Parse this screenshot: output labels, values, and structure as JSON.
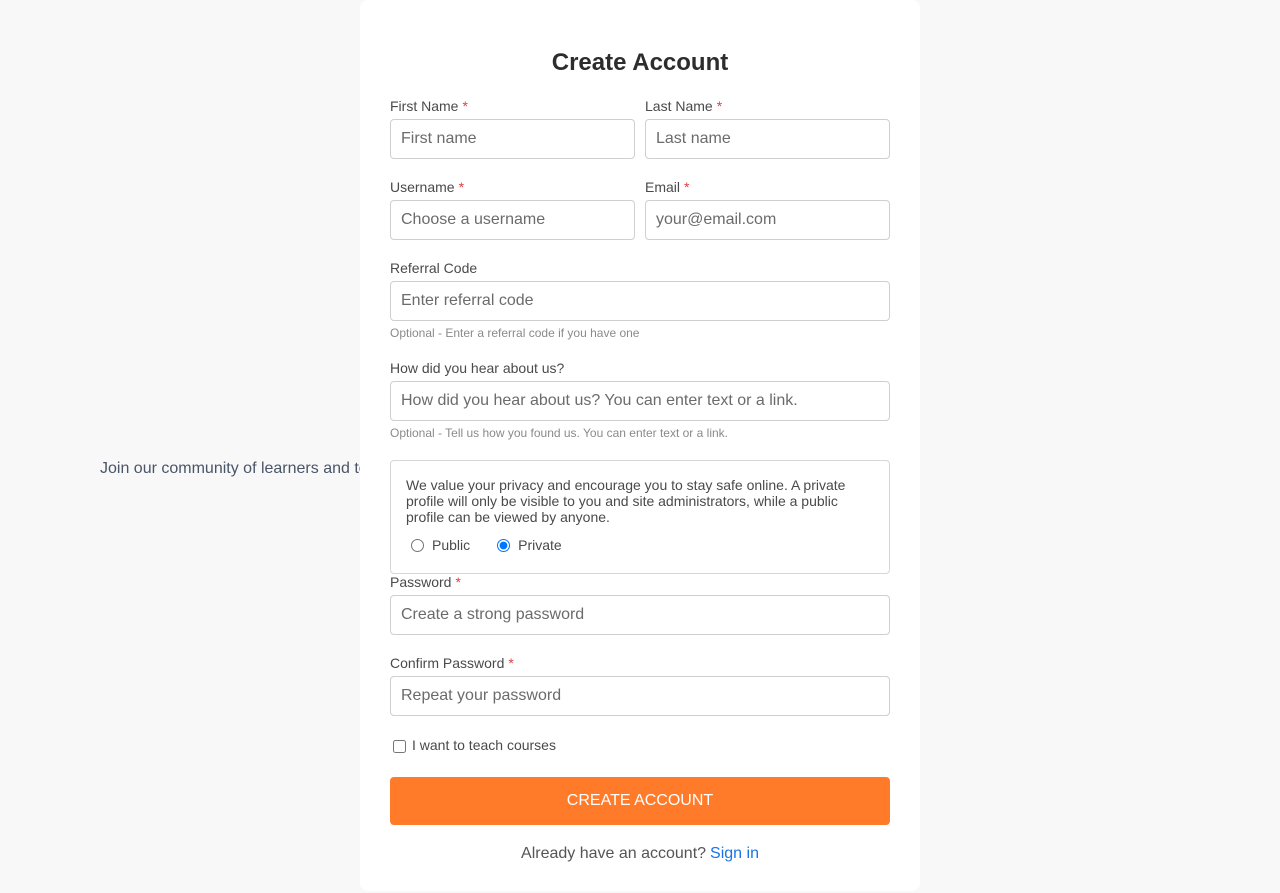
{
  "tagline": "Join our community of learners and teachers",
  "form": {
    "title": "Create Account",
    "required_mark": "*",
    "first_name": {
      "label": "First Name",
      "placeholder": "First name"
    },
    "last_name": {
      "label": "Last Name",
      "placeholder": "Last name"
    },
    "username": {
      "label": "Username",
      "placeholder": "Choose a username"
    },
    "email": {
      "label": "Email",
      "placeholder": "your@email.com"
    },
    "referral": {
      "label": "Referral Code",
      "placeholder": "Enter referral code",
      "hint": "Optional - Enter a referral code if you have one"
    },
    "source": {
      "label": "How did you hear about us?",
      "placeholder": "How did you hear about us? You can enter text or a link.",
      "hint": "Optional - Tell us how you found us. You can enter text or a link."
    },
    "privacy": {
      "text": "We value your privacy and encourage you to stay safe online. A private profile will only be visible to you and site administrators, while a public profile can be viewed by anyone.",
      "options": [
        {
          "label": "Public",
          "selected": false
        },
        {
          "label": "Private",
          "selected": true
        }
      ]
    },
    "password": {
      "label": "Password",
      "placeholder": "Create a strong password"
    },
    "confirm_password": {
      "label": "Confirm Password",
      "placeholder": "Repeat your password"
    },
    "teach_checkbox": {
      "label": "I want to teach courses",
      "checked": false
    },
    "submit_label": "Create Account",
    "signin_prompt": "Already have an account?",
    "signin_link": "Sign in"
  },
  "colors": {
    "accent": "#ff7a29",
    "link": "#1a73e8",
    "required": "#e53e3e",
    "background": "#f8f8f8"
  }
}
